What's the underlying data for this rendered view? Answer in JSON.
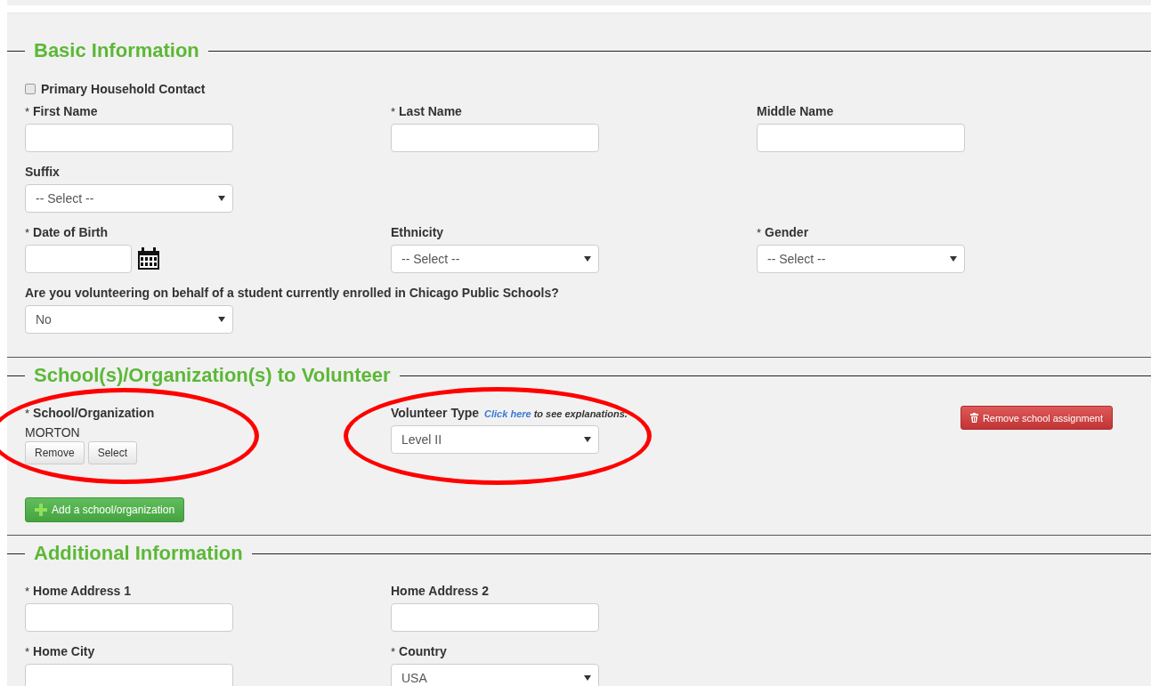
{
  "sections": [
    {
      "title": "Basic Information",
      "rows": [
        [
          {
            "kind": "checkbox",
            "label": "Primary Household Contact",
            "checked": false
          }
        ],
        [
          {
            "kind": "text",
            "mark": "*",
            "label": "First Name"
          },
          {
            "kind": "text",
            "mark": "*",
            "label": "Last Name"
          },
          {
            "kind": "text",
            "label": "Middle Name"
          }
        ],
        [
          {
            "kind": "select",
            "label": "Suffix",
            "value": "-- Select --"
          }
        ],
        [
          {
            "kind": "date",
            "mark": "*",
            "label": "Date of Birth"
          },
          {
            "kind": "select",
            "label": "Ethnicity",
            "value": "-- Select --"
          },
          {
            "kind": "select",
            "mark": "*",
            "label": "Gender",
            "value": "-- Select --"
          }
        ],
        [
          {
            "kind": "select",
            "label": "Are you volunteering on behalf of a student currently enrolled in Chicago Public Schools?",
            "value": "No"
          }
        ]
      ]
    },
    {
      "title": "School(s)/Organization(s) to Volunteer",
      "rows": [
        [
          {
            "kind": "school",
            "mark": "*",
            "label": "School/Organization",
            "value": "MORTON",
            "buttons": [
              "Remove",
              "Select"
            ],
            "circled": true
          },
          {
            "kind": "select",
            "label": "Volunteer Type",
            "link": "Click here",
            "note": "to see explanations.",
            "value": "Level II",
            "circled": true
          },
          {
            "kind": "danger",
            "label": "Remove school assignment"
          }
        ],
        [
          {
            "kind": "add",
            "label": "Add a school/organization"
          }
        ]
      ]
    },
    {
      "title": "Additional Information",
      "rows": [
        [
          {
            "kind": "text",
            "mark": "*",
            "label": "Home Address 1"
          },
          {
            "kind": "text",
            "label": "Home Address 2"
          }
        ],
        [
          {
            "kind": "text",
            "mark": "*",
            "label": "Home City"
          },
          {
            "kind": "select",
            "mark": "*",
            "label": "Country",
            "value": "USA"
          }
        ]
      ]
    }
  ]
}
